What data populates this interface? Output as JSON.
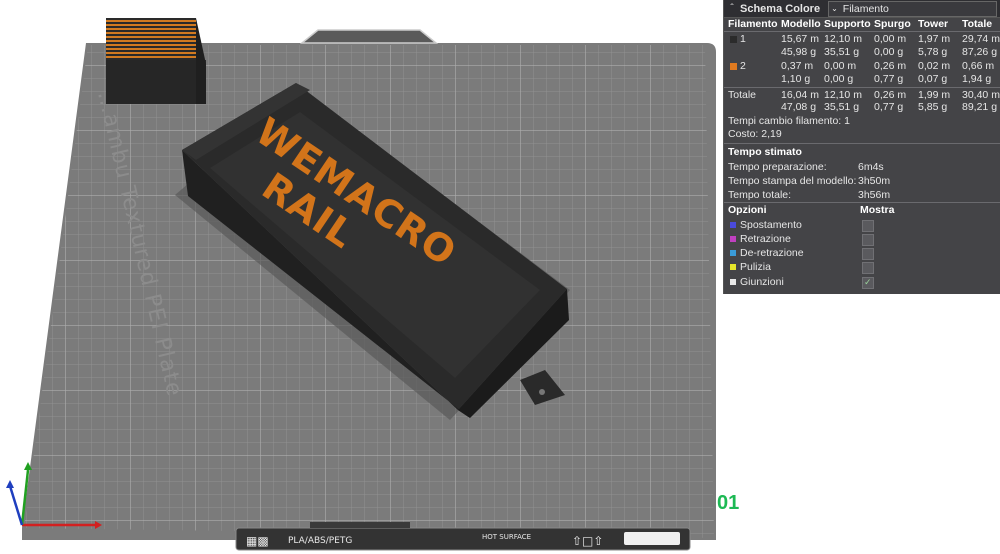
{
  "viewport": {
    "plate_label": "…ambu Textured PEI Plate",
    "model_text_line1": "WEMACRO",
    "model_text_line2": "RAIL",
    "plate_number": "01",
    "bottom_bar": {
      "filament_types": "PLA/ABS/PETG",
      "surface_label": "HOT SURFACE"
    }
  },
  "stats_panel": {
    "title": "Schema Colore",
    "mode_select": "Filamento",
    "headers": [
      "Filamento",
      "Modello",
      "Supporto",
      "Spurgo",
      "Tower",
      "Totale"
    ],
    "filaments": [
      {
        "id": "1",
        "color": "#2b2b2b",
        "length": [
          "15,67 m",
          "12,10 m",
          "0,00 m",
          "1,97 m",
          "29,74 m"
        ],
        "weight": [
          "45,98 g",
          "35,51 g",
          "0,00 g",
          "5,78 g",
          "87,26 g"
        ]
      },
      {
        "id": "2",
        "color": "#e07a1f",
        "length": [
          "0,37 m",
          "0,00 m",
          "0,26 m",
          "0,02 m",
          "0,66 m"
        ],
        "weight": [
          "1,10 g",
          "0,00 g",
          "0,77 g",
          "0,07 g",
          "1,94 g"
        ]
      }
    ],
    "total": {
      "label": "Totale",
      "length": [
        "16,04 m",
        "12,10 m",
        "0,26 m",
        "1,99 m",
        "30,40 m"
      ],
      "weight": [
        "47,08 g",
        "35,51 g",
        "0,77 g",
        "5,85 g",
        "89,21 g"
      ]
    },
    "filament_changes": "Tempi cambio filamento: 1",
    "cost": "Costo: 2,19",
    "time_title": "Tempo stimato",
    "times": [
      {
        "label": "Tempo preparazione:",
        "value": "6m4s"
      },
      {
        "label": "Tempo stampa del modello:",
        "value": "3h50m"
      },
      {
        "label": "Tempo totale:",
        "value": "3h56m"
      }
    ],
    "options_title": "Opzioni",
    "show_title": "Mostra",
    "options": [
      {
        "label": "Spostamento",
        "color": "#4a4adc",
        "checked": false
      },
      {
        "label": "Retrazione",
        "color": "#c040c0",
        "checked": false
      },
      {
        "label": "De-retrazione",
        "color": "#3a9bd8",
        "checked": false
      },
      {
        "label": "Pulizia",
        "color": "#e6e62a",
        "checked": false
      },
      {
        "label": "Giunzioni",
        "color": "#e8e8e8",
        "checked": true
      }
    ]
  }
}
